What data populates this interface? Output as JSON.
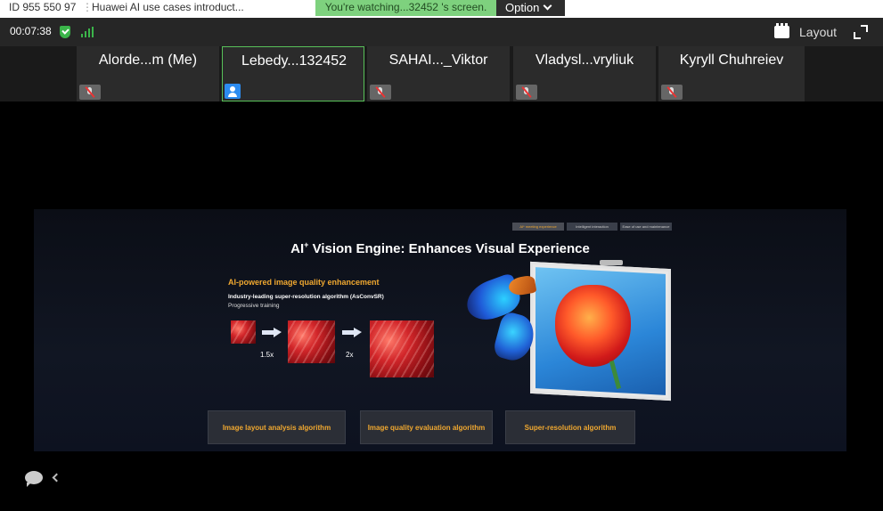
{
  "titlebar": {
    "meeting_id": "ID 955 550 97",
    "meeting_title": "Huawei AI use cases introduct...",
    "watch_banner": "You're watching...32452 's screen.",
    "option_label": "Option"
  },
  "toolbar": {
    "timer": "00:07:38",
    "layout_label": "Layout"
  },
  "participants": [
    {
      "name": "Alorde...m (Me)",
      "status": "muted"
    },
    {
      "name": "Lebedy...132452",
      "status": "sharing"
    },
    {
      "name": "SAHAI..._Viktor",
      "status": "muted"
    },
    {
      "name": "Vladysl...vryliuk",
      "status": "muted"
    },
    {
      "name": "Kyryll Chuhreiev",
      "status": "muted"
    }
  ],
  "slide": {
    "tabs": [
      "AI* meeting experience",
      "Intelligent interaction",
      "Ease of use and maintenance"
    ],
    "title_pre": "AI",
    "title_sup": "+",
    "title_post": " Vision Engine: Enhances Visual Experience",
    "feature_heading": "AI-powered image quality enhancement",
    "feature_sub": "Industry-leading super-resolution algorithm (AsConvSR)",
    "feature_sub2": "Progressive training",
    "scale_1": "1.5x",
    "scale_2": "2x",
    "algorithms": [
      "Image layout analysis algorithm",
      "Image quality evaluation algorithm",
      "Super-resolution algorithm"
    ]
  },
  "colors": {
    "accent_orange": "#f0a830",
    "active_green": "#58c159",
    "banner_green": "#7ed17e"
  }
}
